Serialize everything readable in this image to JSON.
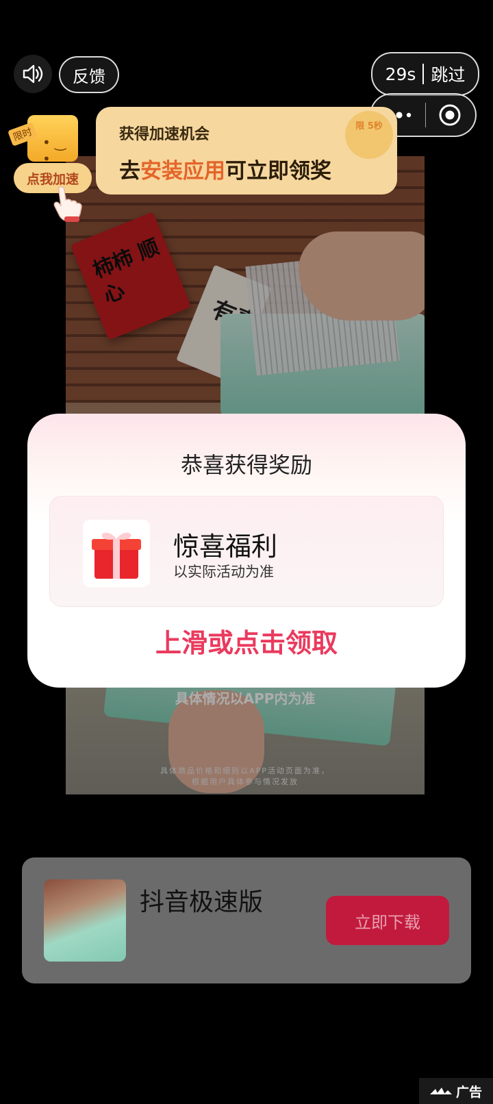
{
  "top_bar": {
    "feedback_label": "反馈",
    "skip_countdown": "29s",
    "skip_label": "跳过",
    "icons": [
      "speaker-icon",
      "more-dots-icon",
      "target-icon"
    ]
  },
  "accelerate": {
    "limited_tag": "限时",
    "button_label": "点我加速",
    "banner_line1": "获得加速机会",
    "banner_prefix": "去",
    "banner_highlight": "安装应用",
    "banner_suffix": "可立即领奖",
    "stamp_text": "限 5秒"
  },
  "video": {
    "overlay_main": "具体情况以APP内为准",
    "overlay_small_1": "具体商品价格和细则以APP活动页面为准，",
    "overlay_small_2": "根据用户具体参与情况发放",
    "red_card_text": "柿柿 顺心",
    "white_card_text": "有喜"
  },
  "reward_popup": {
    "title": "恭喜获得奖励",
    "reward_name": "惊喜福利",
    "reward_note": "以实际活动为准",
    "claim_label": "上滑或点击领取",
    "colors": {
      "accent": "#ea3a5e"
    }
  },
  "app_card": {
    "app_name": "抖音极速版",
    "download_label": "立即下载",
    "colors": {
      "button": "#c21a3d"
    }
  },
  "ad_tag": {
    "label": "广告"
  }
}
